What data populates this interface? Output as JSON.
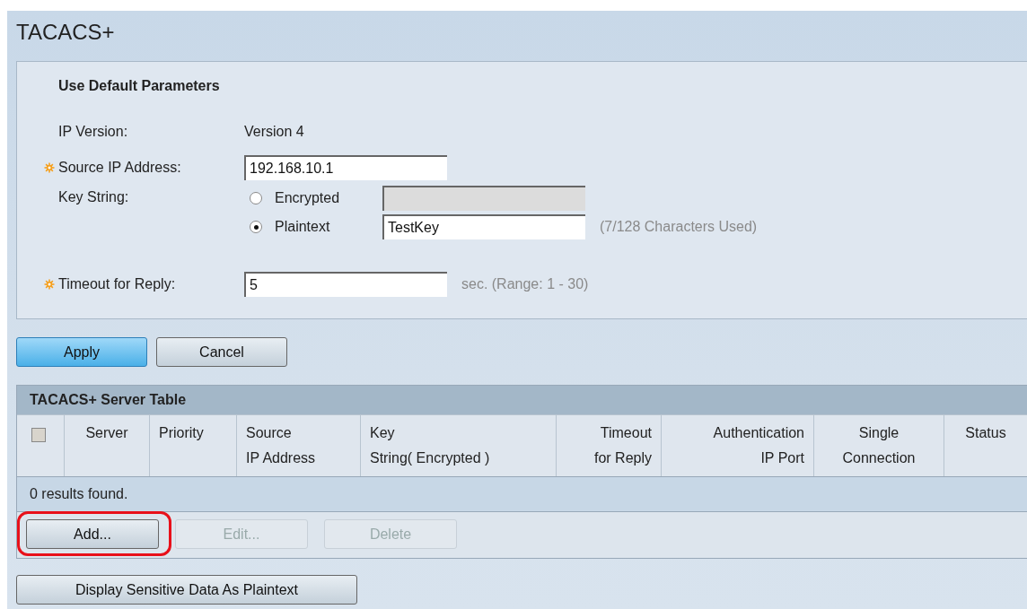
{
  "title": "TACACS+",
  "form": {
    "heading": "Use Default Parameters",
    "ip_version": {
      "label": "IP Version:",
      "value": "Version 4"
    },
    "source_ip": {
      "label": "Source IP Address:",
      "required": true,
      "value": "192.168.10.1"
    },
    "key_string": {
      "label": "Key String:",
      "options": [
        {
          "label": "Encrypted",
          "selected": false,
          "disabled": true
        },
        {
          "label": "Plaintext",
          "selected": true,
          "disabled": false,
          "value": "TestKey",
          "hint": "(7/128 Characters Used)"
        }
      ]
    },
    "timeout": {
      "label": "Timeout for Reply:",
      "required": true,
      "value": "5",
      "hint": "sec. (Range: 1 - 30)"
    }
  },
  "form_buttons": [
    {
      "label": "Apply",
      "primary": true
    },
    {
      "label": "Cancel",
      "primary": false
    }
  ],
  "table": {
    "title": "TACACS+ Server Table",
    "select_all_checked": false,
    "columns": [
      {
        "lines": [
          "Server"
        ]
      },
      {
        "lines": [
          "Priority"
        ]
      },
      {
        "lines": [
          "Source",
          "IP Address"
        ]
      },
      {
        "lines": [
          "Key",
          "String( Encrypted )"
        ]
      },
      {
        "lines": [
          "Timeout",
          "for Reply"
        ]
      },
      {
        "lines": [
          "Authentication",
          "IP Port"
        ]
      },
      {
        "lines": [
          "Single",
          "Connection"
        ]
      },
      {
        "lines": [
          "Status"
        ]
      }
    ],
    "empty_message": "0 results found."
  },
  "table_buttons": [
    {
      "label": "Add...",
      "disabled": false,
      "highlighted": true
    },
    {
      "label": "Edit...",
      "disabled": true,
      "highlighted": false
    },
    {
      "label": "Delete",
      "disabled": true,
      "highlighted": false
    }
  ],
  "bottom_button": {
    "label": "Display Sensitive Data As Plaintext"
  }
}
